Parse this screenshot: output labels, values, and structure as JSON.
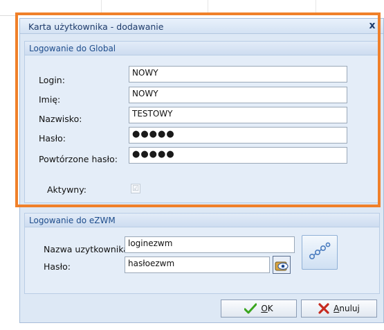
{
  "window": {
    "title": "Karta użytkownika - dodawanie",
    "close_label": "x"
  },
  "global_group": {
    "title": "Logowanie do Global",
    "login": {
      "label": "Login:",
      "value": "NOWY"
    },
    "first_name": {
      "label": "Imię:",
      "value": "NOWY"
    },
    "last_name": {
      "label": "Nazwisko:",
      "value": "TESTOWY"
    },
    "password": {
      "label": "Hasło:",
      "value": "●●●●●"
    },
    "password_repeat": {
      "label": "Powtórzone hasło:",
      "value": "●●●●●"
    },
    "active": {
      "label": "Aktywny:",
      "checked": true,
      "check_glyph": "☑"
    }
  },
  "ezwm_group": {
    "title": "Logowanie do eZWM",
    "username": {
      "label": "Nazwa uzytkownika",
      "value": "loginezwm"
    },
    "password": {
      "label": "Hasło:",
      "value": "hasłoezwm"
    }
  },
  "buttons": {
    "ok": {
      "label_prefix": "",
      "mnemonic": "O",
      "label_rest": "K"
    },
    "cancel": {
      "mnemonic": "A",
      "label_rest": "nuluj"
    }
  },
  "colors": {
    "highlight": "#f0802a",
    "ok_check": "#3aa51e",
    "cancel_x": "#c62a1f"
  }
}
